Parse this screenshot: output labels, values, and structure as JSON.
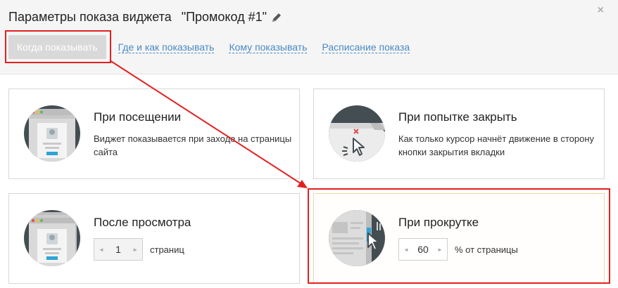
{
  "header": {
    "title": "Параметры показа виджета",
    "widget_name": "\"Промокод #1\"",
    "close_label": "×"
  },
  "tabs": [
    {
      "label": "Когда показывать",
      "active": true
    },
    {
      "label": "Где и как показывать",
      "active": false
    },
    {
      "label": "Кому показывать",
      "active": false
    },
    {
      "label": "Расписание показа",
      "active": false
    }
  ],
  "cards": [
    {
      "title": "При посещении",
      "desc": "Виджет показывается при заходе на страницы сайта"
    },
    {
      "title": "При попытке закрыть",
      "desc": "Как только курсор начнёт движение в сторону кнопки закрытия вкладки"
    },
    {
      "title": "После просмотра",
      "value": "1",
      "unit": "страниц"
    },
    {
      "title": "При прокрутке",
      "value": "60",
      "unit": "% от страницы"
    }
  ],
  "stepper": {
    "dec": "◄",
    "inc": "►"
  },
  "colors": {
    "link": "#4a8ac4",
    "tab_active_bg": "#d9d9d9",
    "annotation": "#e32020",
    "icon_dark": "#444d52",
    "accent_blue": "#2ea3d6"
  }
}
